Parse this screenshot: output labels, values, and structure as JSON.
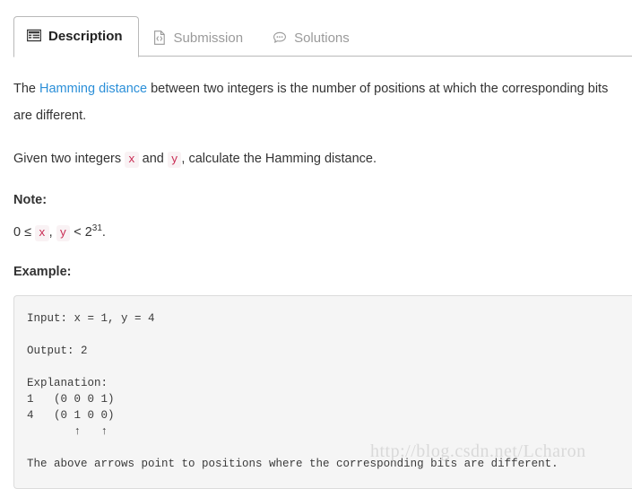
{
  "tabs": [
    {
      "label": "Description",
      "icon": "list-icon",
      "active": true
    },
    {
      "label": "Submission",
      "icon": "file-code-icon",
      "active": false
    },
    {
      "label": "Solutions",
      "icon": "comment-icon",
      "active": false
    }
  ],
  "description": {
    "intro_before_link": "The ",
    "intro_link": "Hamming distance",
    "intro_after_link": " between two integers is the number of positions at which the corresponding bits are different.",
    "given_before": "Given two integers ",
    "given_code_x": "x",
    "given_middle": " and ",
    "given_code_y": "y",
    "given_after": ", calculate the Hamming distance."
  },
  "note": {
    "heading": "Note:",
    "math_prefix": "0 ≤ ",
    "math_code_x": "x",
    "math_comma": ", ",
    "math_code_y": "y",
    "math_mid": " < 2",
    "math_sup": "31",
    "math_suffix": "."
  },
  "example": {
    "heading": "Example:",
    "code": "Input: x = 1, y = 4\n\nOutput: 2\n\nExplanation:\n1   (0 0 0 1)\n4   (0 1 0 0)\n       ↑   ↑\n\nThe above arrows point to positions where the corresponding bits are different."
  },
  "watermark": {
    "text": "http://blog.csdn.net/Lcharon"
  },
  "colors": {
    "link": "#2b8fd8",
    "inline_code_text": "#c7254e",
    "inline_code_bg": "#f9f2f4",
    "code_block_bg": "#f5f5f5",
    "code_block_border": "#dcdcdc",
    "tab_active_text": "#222222",
    "tab_inactive_text": "#9a9a9a",
    "tab_border": "#b9b9b9",
    "watermark": "#d9d9d9"
  }
}
